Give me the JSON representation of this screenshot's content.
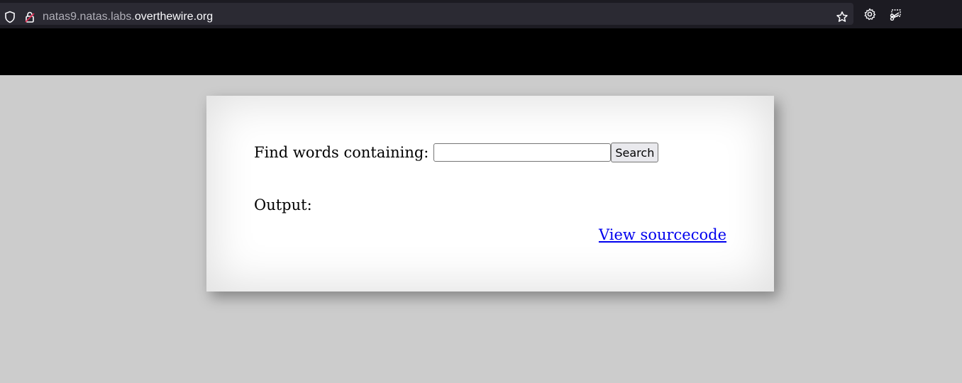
{
  "browser": {
    "url_prefix": "natas9.natas.labs.",
    "url_domain": "overthewire.org",
    "icons": [
      "shield-icon",
      "lock-icon",
      "star-icon",
      "gear-icon",
      "extension-icon"
    ]
  },
  "form": {
    "label": "Find words containing:",
    "input_value": "",
    "button_label": "Search"
  },
  "output": {
    "label": "Output:"
  },
  "links": {
    "view_source": "View sourcecode"
  },
  "colors": {
    "page_background": "#cccccc",
    "header_band": "#000000",
    "content_background": "#ffffff",
    "link": "#0000ee"
  }
}
